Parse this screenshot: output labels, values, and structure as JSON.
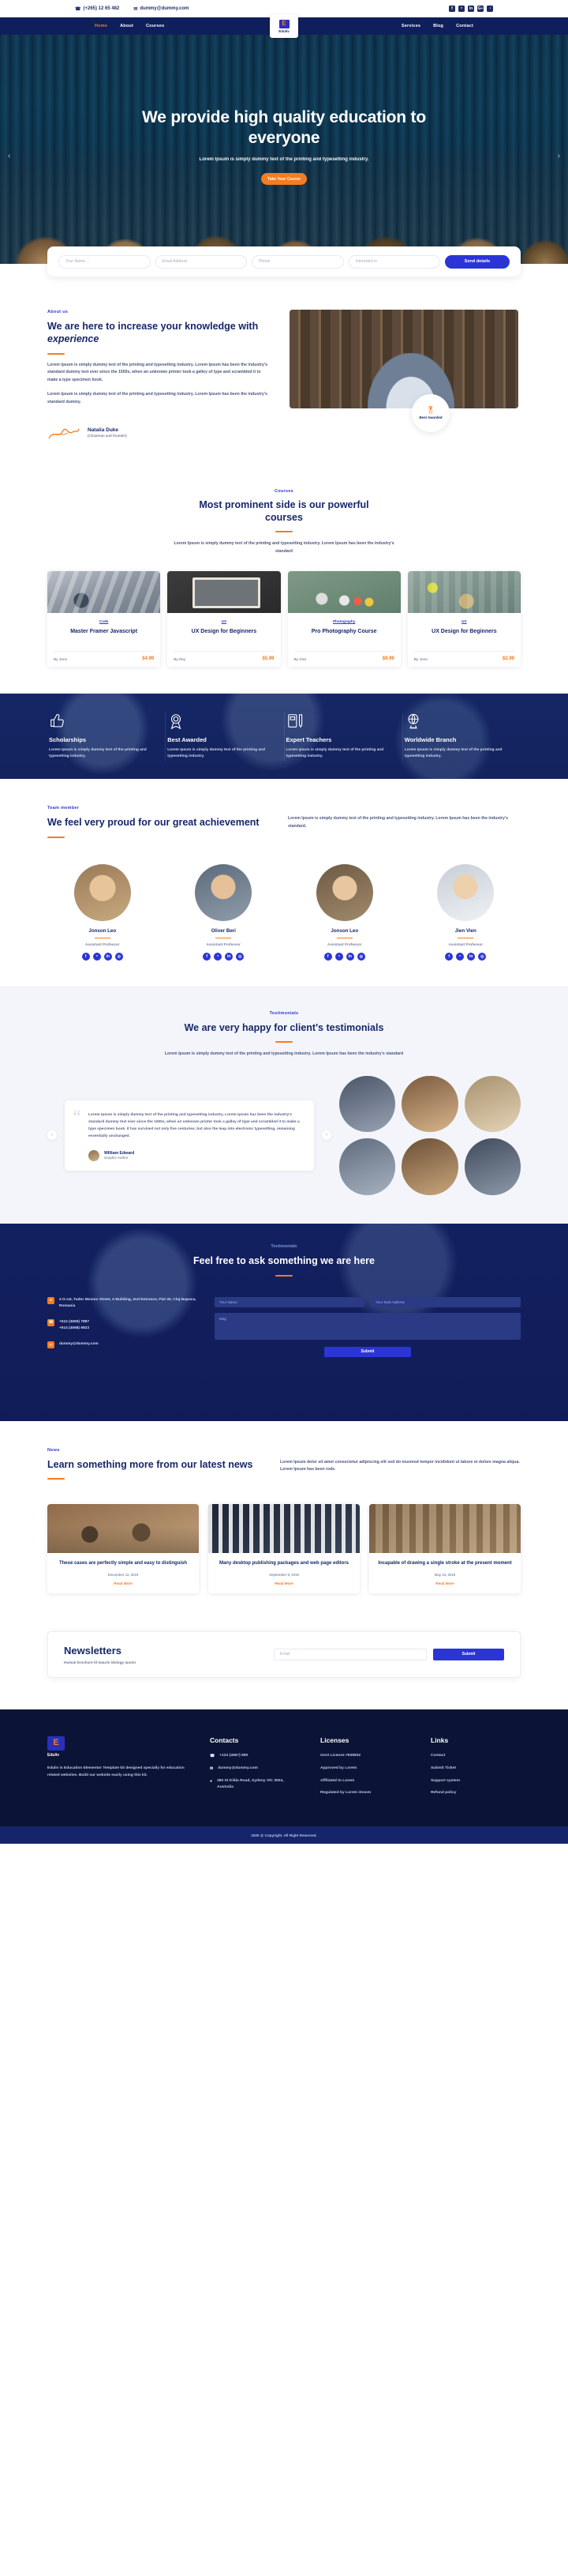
{
  "brand": {
    "name": "Eduliv",
    "letter": "E",
    "accent": "#f57c1f",
    "primary": "#2b35d6",
    "dark": "#16246a"
  },
  "topbar": {
    "phone": "(+265) 12 65 482",
    "email": "dummy@dummy.com",
    "phone_icon": "phone-icon",
    "email_icon": "envelope-icon",
    "social": [
      {
        "name": "facebook-icon",
        "glyph": "f"
      },
      {
        "name": "twitter-icon",
        "glyph": "ᵛ"
      },
      {
        "name": "linkedin-icon",
        "glyph": "in"
      },
      {
        "name": "googleplus-icon",
        "glyph": "G+"
      },
      {
        "name": "rss-icon",
        "glyph": "◔"
      }
    ]
  },
  "nav": {
    "left": [
      {
        "label": "Home",
        "active": true
      },
      {
        "label": "About",
        "active": false
      },
      {
        "label": "Courses",
        "active": false
      }
    ],
    "right": [
      {
        "label": "Services",
        "active": false
      },
      {
        "label": "Blog",
        "active": false
      },
      {
        "label": "Contact",
        "active": false
      }
    ]
  },
  "hero": {
    "title": "We provide high quality education to everyone",
    "subtitle": "Lorem Ipsum is simply dummy text of the printing and typesetting industry.",
    "cta": "Take Your Course",
    "prev": "‹",
    "next": "›"
  },
  "search": {
    "name_placeholder": "Your Name ...",
    "email_placeholder": "Email Address",
    "phone_placeholder": "Phone",
    "interest_placeholder": "Interested in",
    "submit": "Send details"
  },
  "about": {
    "eyebrow": "About us",
    "title_1": "We are here to increase your knowledge with ",
    "title_em": "experience",
    "p1": "Lorem Ipsum is simply dummy text of the printing and typesetting industry. Lorem Ipsum has been the industry's standard dummy text ever since the 1500s, when an unknown printer took a galley of type and scrambled it to make a type specimen book.",
    "p2": "Lorem Ipsum is simply dummy text of the printing and typesetting industry. Lorem Ipsum has been the industry's standard dummy.",
    "signer_name": "Natalia Duke",
    "signer_role": "(Chairman and founder)",
    "badge_icon": "award-ribbon-icon",
    "badge_text": "Best Awarded"
  },
  "courses": {
    "eyebrow": "Courses",
    "title": "Most prominent side is our powerful courses",
    "desc": "Lorem Ipsum is simply dummy text of the printing and typesetting industry. Lorem Ipsum has been the industry's standard",
    "items": [
      {
        "tag": "Code",
        "title": "Master Framer Javascript",
        "by": "By Jone",
        "price": "$4.99"
      },
      {
        "tag": "UX",
        "title": "UX Design for Beginners",
        "by": "By Roy",
        "price": "$5.99"
      },
      {
        "tag": "Photography",
        "title": "Pro Photography Course",
        "by": "By Alex",
        "price": "$9.99"
      },
      {
        "tag": "UX",
        "title": "UX Design for Beginners",
        "by": "By Jone",
        "price": "$2.99"
      }
    ]
  },
  "features": [
    {
      "icon": "thumbs-up-icon",
      "title": "Scholarships",
      "text": "Lorem Ipsum is simply dummy text of the printing and typesetting industry."
    },
    {
      "icon": "award-medal-icon",
      "title": "Best Awarded",
      "text": "Lorem Ipsum is simply dummy text of the printing and typesetting industry."
    },
    {
      "icon": "book-pencil-icon",
      "title": "Expert Teachers",
      "text": "Lorem Ipsum is simply dummy text of the printing and typesetting industry."
    },
    {
      "icon": "globe-stand-icon",
      "title": "Worldwide Branch",
      "text": "Lorem Ipsum is simply dummy text of the printing and typesetting industry."
    }
  ],
  "team": {
    "eyebrow": "Team member",
    "title": "We feel very proud for our great achievement",
    "desc": "Lorem Ipsum is simply dummy text of the printing and typesetting industry. Lorem Ipsum has been the industry's standard.",
    "members": [
      {
        "name": "Jonson Leo",
        "role": "Assistant Professor"
      },
      {
        "name": "Oliver Beri",
        "role": "Assistant Professor"
      },
      {
        "name": "Jonson Leo",
        "role": "Assistant Professor"
      },
      {
        "name": "Jien Vien",
        "role": "Assistant Professor"
      }
    ],
    "social": [
      {
        "name": "facebook-icon",
        "glyph": "f"
      },
      {
        "name": "twitter-icon",
        "glyph": "ᵛ"
      },
      {
        "name": "linkedin-icon",
        "glyph": "in"
      },
      {
        "name": "instagram-icon",
        "glyph": "◎"
      }
    ]
  },
  "testimonials": {
    "eyebrow": "Testimonials",
    "title": "We are very happy for client's testimonials",
    "desc": "Lorem Ipsum is simply dummy text of the printing and typesetting industry. Lorem Ipsum has been the industry's standard",
    "quote": "Lorem Ipsum is simply dummy text of the printing and typesetting industry. Lorem Ipsum has been the industry's standard dummy text ever since the 1500s, when an unknown printer took a galley of type and scrambled it to make a type specimen book. It has survived not only five centuries, but also the leap into electronic typesetting, remaining essentially unchanged.",
    "author": "William Edward",
    "author_role": "Graphic Author",
    "prev": "‹",
    "next": "›"
  },
  "contact": {
    "eyebrow": "Testimonials",
    "title": "Feel free to ask something we are here",
    "address_icon": "map-pin-icon",
    "address": "4 G-rat, Tudor Mosmo Street, A Building, 2nd Entrance, Flat 30, Cluj-Napoca, Romania",
    "phone_icon": "phone-icon",
    "phone1": "+512 (4565) 7887",
    "phone2": "+514 (4568) 6923",
    "email_icon": "envelope-icon",
    "email": "dummy@dummy.com",
    "f_name": "Your Name",
    "f_email": "Your Mail Address",
    "f_msg": "Msg",
    "submit": "Submit"
  },
  "news": {
    "eyebrow": "News",
    "title": "Learn something more from our latest news",
    "desc": "Lorem Ipsum dolor sit amet consectetur adipiscing elit sed do eiusmod tempor incididunt ut labore et dolore magna aliqua. Lorem Ipsum has been rode.",
    "items": [
      {
        "title": "These cases are perfectly simple and easy to distinguish",
        "date": "December 12, 2019",
        "more": "Read More"
      },
      {
        "title": "Many desktop publishing packages and web page editors",
        "date": "September 9, 2019",
        "more": "Read More"
      },
      {
        "title": "Incapable of drawing a single stroke at the present moment",
        "date": "May 23, 2019",
        "more": "Read More"
      }
    ]
  },
  "newsletter": {
    "title": "Newsletters",
    "subtitle": "Human brochure til mauris idology auctor",
    "placeholder": "Email",
    "button": "Submit"
  },
  "footer": {
    "desc": "Eduliv is Education Elementor Template kit designed specially for education related websites. Build our website easily using this kit.",
    "contacts": {
      "heading": "Contacts",
      "items": [
        {
          "icon": "phone-icon",
          "text": "+123 (4567) 890"
        },
        {
          "icon": "envelope-icon",
          "text": "dummy@dummy.com"
        },
        {
          "icon": "map-pin-icon",
          "text": "380 St Kilda Road, Sydeny VIC 3004, Australia"
        }
      ]
    },
    "licenses": {
      "heading": "Licenses",
      "items": [
        "Govt License #938932",
        "Approved by Lorem",
        "Affiliated to Lorem",
        "Regulated by Lorem imsum"
      ]
    },
    "links": {
      "heading": "Links",
      "items": [
        "Contact",
        "Submit Ticket",
        "Support system",
        "Refund policy"
      ]
    },
    "copyright": "2020 @ Copyright. All Right Reserved."
  }
}
